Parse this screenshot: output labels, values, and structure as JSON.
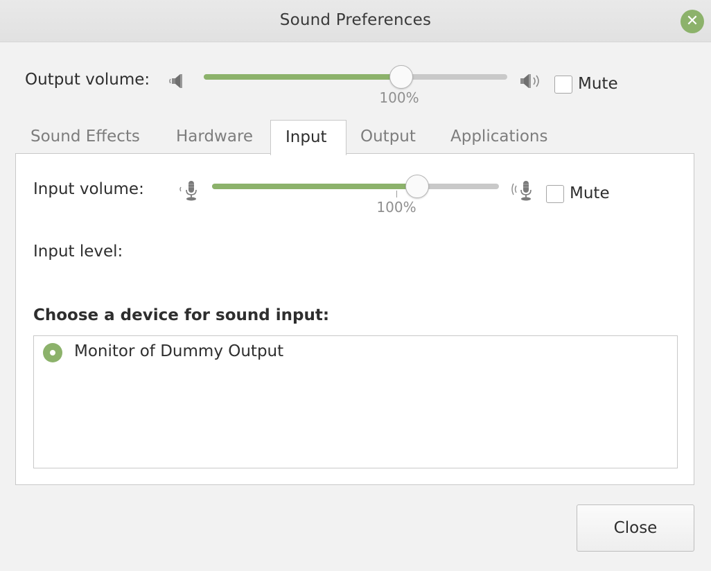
{
  "window": {
    "title": "Sound Preferences",
    "close_glyph": "✕"
  },
  "output": {
    "label": "Output volume:",
    "volume": 1.0,
    "volume_text": "100%",
    "mute_label": "Mute",
    "muted": false
  },
  "tabs": [
    {
      "label": "Sound Effects",
      "active": false
    },
    {
      "label": "Hardware",
      "active": false
    },
    {
      "label": "Input",
      "active": true
    },
    {
      "label": "Output",
      "active": false
    },
    {
      "label": "Applications",
      "active": false
    }
  ],
  "input": {
    "volume_label": "Input volume:",
    "volume": 1.0,
    "volume_text": "100%",
    "mute_label": "Mute",
    "muted": false,
    "level_label": "Input level:",
    "device_heading": "Choose a device for sound input:",
    "devices": [
      {
        "name": "Monitor of Dummy Output",
        "selected": true
      }
    ]
  },
  "footer": {
    "close_label": "Close"
  },
  "colors": {
    "accent": "#8cb26b",
    "track": "#c9c9c9",
    "window_bg": "#f2f2f2"
  },
  "icons": [
    "close-icon",
    "speaker-low-icon",
    "speaker-high-icon",
    "microphone-low-icon",
    "microphone-high-icon"
  ]
}
